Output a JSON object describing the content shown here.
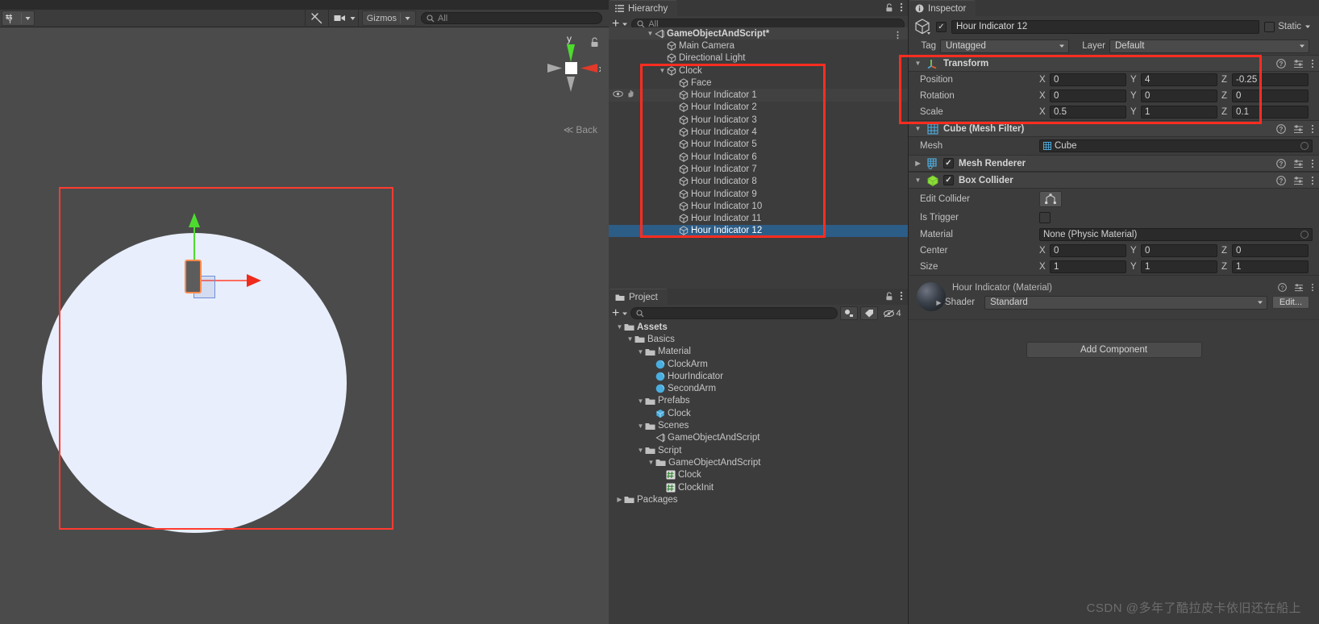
{
  "app": {
    "name": "Unity Editor"
  },
  "scene_toolbar": {
    "pivot_label": "Pivot/Y",
    "tools_icon": "tools-icon",
    "camera_icon": "camera-icon",
    "gizmos_label": "Gizmos",
    "search_placeholder": "All",
    "search_value": "",
    "search_icon": "search-icon"
  },
  "scene_view": {
    "nav_gizmo": {
      "y_label": "y",
      "x_label": "x"
    },
    "back_label": "Back",
    "lock_icon": "lock-icon",
    "face_object": "Face",
    "selected_gizmo": "move-tool-gizmo"
  },
  "hierarchy": {
    "tab_label": "Hierarchy",
    "tab_icon": "hierarchy-icon",
    "lock_icon": "lock-icon",
    "menu_icon": "kebab-menu-icon",
    "add_label": "+",
    "search_placeholder": "All",
    "search_value": "",
    "rows": [
      {
        "label": "GameObjectAndScript*",
        "indent": 0,
        "icon": "scene-icon",
        "expanded": true,
        "state": "scene",
        "menu": true
      },
      {
        "label": "Main Camera",
        "indent": 1,
        "icon": "gameobject-icon",
        "state": "normal"
      },
      {
        "label": "Directional Light",
        "indent": 1,
        "icon": "gameobject-icon",
        "state": "normal"
      },
      {
        "label": "Clock",
        "indent": 1,
        "icon": "gameobject-icon",
        "expanded": true,
        "state": "normal"
      },
      {
        "label": "Face",
        "indent": 2,
        "icon": "gameobject-icon",
        "state": "normal"
      },
      {
        "label": "Hour Indicator 1",
        "indent": 2,
        "icon": "gameobject-icon",
        "state": "hover",
        "vis": true
      },
      {
        "label": "Hour Indicator 2",
        "indent": 2,
        "icon": "gameobject-icon",
        "state": "normal"
      },
      {
        "label": "Hour Indicator 3",
        "indent": 2,
        "icon": "gameobject-icon",
        "state": "normal"
      },
      {
        "label": "Hour Indicator 4",
        "indent": 2,
        "icon": "gameobject-icon",
        "state": "normal"
      },
      {
        "label": "Hour Indicator 5",
        "indent": 2,
        "icon": "gameobject-icon",
        "state": "normal"
      },
      {
        "label": "Hour Indicator 6",
        "indent": 2,
        "icon": "gameobject-icon",
        "state": "normal"
      },
      {
        "label": "Hour Indicator 7",
        "indent": 2,
        "icon": "gameobject-icon",
        "state": "normal"
      },
      {
        "label": "Hour Indicator 8",
        "indent": 2,
        "icon": "gameobject-icon",
        "state": "normal"
      },
      {
        "label": "Hour Indicator 9",
        "indent": 2,
        "icon": "gameobject-icon",
        "state": "normal"
      },
      {
        "label": "Hour Indicator 10",
        "indent": 2,
        "icon": "gameobject-icon",
        "state": "normal"
      },
      {
        "label": "Hour Indicator 11",
        "indent": 2,
        "icon": "gameobject-icon",
        "state": "normal"
      },
      {
        "label": "Hour Indicator 12",
        "indent": 2,
        "icon": "gameobject-icon",
        "state": "selected"
      }
    ]
  },
  "project": {
    "tab_label": "Project",
    "tab_icon": "folder-icon",
    "lock_icon": "lock-icon",
    "menu_icon": "kebab-menu-icon",
    "add_label": "+",
    "search_placeholder": "",
    "search_value": "",
    "hidden_count": "4",
    "rows": [
      {
        "label": "Assets",
        "indent": 0,
        "icon": "folder-icon",
        "expanded": true,
        "bold": true
      },
      {
        "label": "Basics",
        "indent": 1,
        "icon": "folder-icon",
        "expanded": true
      },
      {
        "label": "Material",
        "indent": 2,
        "icon": "folder-icon",
        "expanded": true
      },
      {
        "label": "ClockArm",
        "indent": 3,
        "icon": "material-icon"
      },
      {
        "label": "HourIndicator",
        "indent": 3,
        "icon": "material-icon"
      },
      {
        "label": "SecondArm",
        "indent": 3,
        "icon": "material-icon"
      },
      {
        "label": "Prefabs",
        "indent": 2,
        "icon": "folder-icon",
        "expanded": true
      },
      {
        "label": "Clock",
        "indent": 3,
        "icon": "prefab-icon"
      },
      {
        "label": "Scenes",
        "indent": 2,
        "icon": "folder-icon",
        "expanded": true
      },
      {
        "label": "GameObjectAndScript",
        "indent": 3,
        "icon": "scene-icon"
      },
      {
        "label": "Script",
        "indent": 2,
        "icon": "folder-icon",
        "expanded": true
      },
      {
        "label": "GameObjectAndScript",
        "indent": 3,
        "icon": "folder-icon",
        "expanded": true
      },
      {
        "label": "Clock",
        "indent": 4,
        "icon": "csharp-script-icon"
      },
      {
        "label": "ClockInit",
        "indent": 4,
        "icon": "csharp-script-icon"
      },
      {
        "label": "Packages",
        "indent": 0,
        "icon": "folder-icon",
        "expanded": false
      }
    ]
  },
  "inspector": {
    "tab_label": "Inspector",
    "tab_icon": "info-icon",
    "lock_icon": "lock-icon",
    "menu_icon": "kebab-menu-icon",
    "object_icon": "gameobject-icon",
    "enabled_checkbox": true,
    "object_name": "Hour Indicator 12",
    "static_label": "Static",
    "static_checked": false,
    "tag_label": "Tag",
    "tag_value": "Untagged",
    "layer_label": "Layer",
    "layer_value": "Default",
    "transform": {
      "title": "Transform",
      "icon": "transform-icon",
      "help_icon": "help-icon",
      "preset_icon": "preset-icon",
      "menu_icon": "kebab-menu-icon",
      "rows": [
        {
          "label": "Position",
          "x": "0",
          "y": "4",
          "z": "-0.25"
        },
        {
          "label": "Rotation",
          "x": "0",
          "y": "0",
          "z": "0"
        },
        {
          "label": "Scale",
          "x": "0.5",
          "y": "1",
          "z": "0.1"
        }
      ]
    },
    "mesh_filter": {
      "title": "Cube (Mesh Filter)",
      "icon": "mesh-filter-icon",
      "mesh_label": "Mesh",
      "mesh_value": "Cube",
      "mesh_value_icon": "mesh-icon"
    },
    "mesh_renderer": {
      "title": "Mesh Renderer",
      "icon": "mesh-renderer-icon",
      "enabled": true
    },
    "box_collider": {
      "title": "Box Collider",
      "icon": "box-collider-icon",
      "enabled": true,
      "edit_collider_label": "Edit Collider",
      "edit_collider_icon": "edit-collider-icon",
      "is_trigger_label": "Is Trigger",
      "is_trigger_checked": false,
      "material_label": "Material",
      "material_value": "None (Physic Material)",
      "center": {
        "label": "Center",
        "x": "0",
        "y": "0",
        "z": "0"
      },
      "size": {
        "label": "Size",
        "x": "1",
        "y": "1",
        "z": "1"
      }
    },
    "material_block": {
      "title": "Hour Indicator (Material)",
      "preview_icon": "material-sphere-icon",
      "shader_label": "Shader",
      "shader_value": "Standard",
      "edit_label": "Edit..."
    },
    "add_component_label": "Add Component"
  },
  "watermark": {
    "text": "CSDN @多年了酷拉皮卡依旧还在船上"
  },
  "colors": {
    "highlight_red": "#ff2d20",
    "selection_blue": "#2c5d87",
    "panel_bg": "#3c3c3c",
    "window_bg": "#383838",
    "axis_green": "#4ddb2f",
    "axis_red": "#ee2b1c",
    "clock_face": "#e8eefb",
    "scene_bg": "#4b4b4b"
  }
}
